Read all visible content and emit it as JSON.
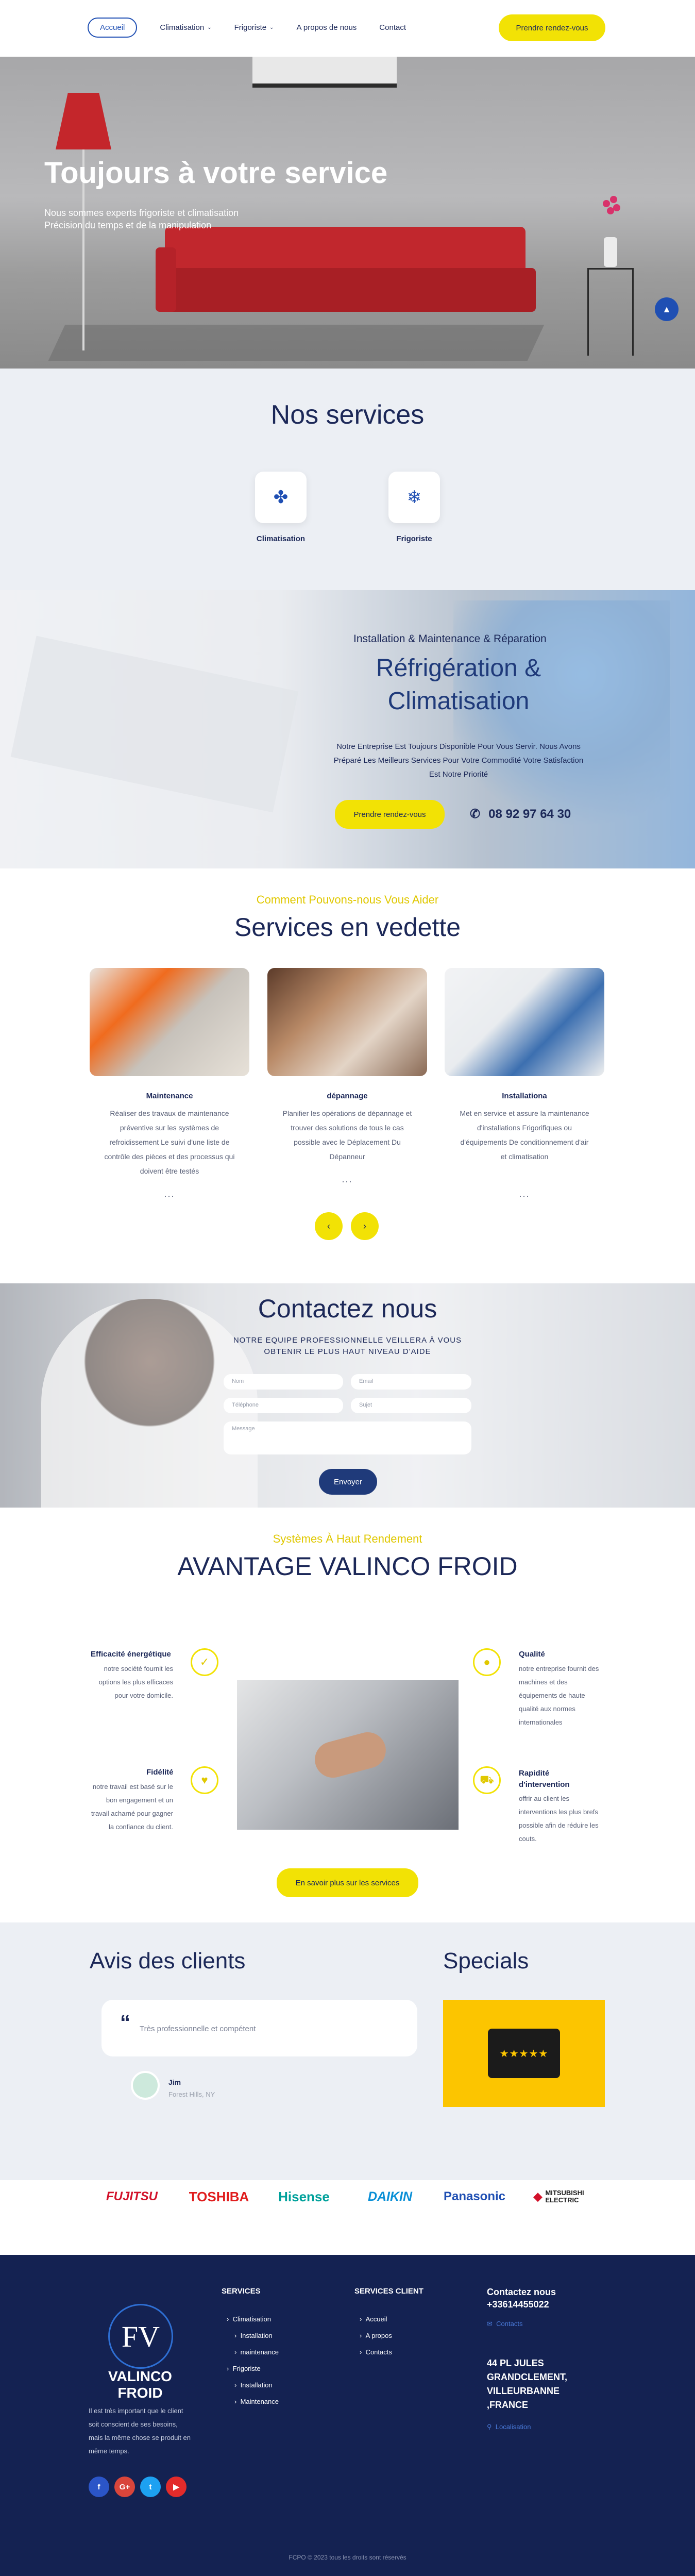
{
  "header": {
    "nav": [
      {
        "label": "Accueil"
      },
      {
        "label": "Climatisation"
      },
      {
        "label": "Frigoriste"
      },
      {
        "label": "A propos de nous"
      },
      {
        "label": "Contact"
      }
    ],
    "cta": "Prendre rendez-vous"
  },
  "hero": {
    "title": "Toujours à votre service",
    "line1": "Nous sommes experts frigoriste et climatisation",
    "line2": "Précision du temps et de la manipulation"
  },
  "services": {
    "title": "Nos services",
    "items": [
      {
        "label": "Climatisation",
        "icon": "fan-icon"
      },
      {
        "label": "Frigoriste",
        "icon": "snowflake-icon"
      }
    ]
  },
  "refrig": {
    "kicker": "Installation & Maintenance & Réparation",
    "title": "Réfrigération & Climatisation",
    "desc": "Notre Entreprise Est Toujours Disponible Pour Vous Servir. Nous Avons Préparé Les Meilleurs Services Pour Votre Commodité Votre Satisfaction Est Notre Priorité",
    "cta": "Prendre rendez-vous",
    "phone": "08 92 97 64 30"
  },
  "featured": {
    "kicker": "Comment Pouvons-nous Vous Aider",
    "title": "Services en vedette",
    "cards": [
      {
        "title": "Maintenance",
        "text": "Réaliser des travaux de maintenance préventive sur les systèmes de refroidissement Le suivi d'une liste de contrôle des pièces et des processus qui doivent être testés",
        "more": "..."
      },
      {
        "title": "dépannage",
        "text": "Planifier les opérations de dépannage et trouver des solutions de tous le cas possible avec le Déplacement Du Dépanneur",
        "more": "..."
      },
      {
        "title": "Installationa",
        "text": "Met en service et assure la maintenance d'installations Frigorifiques ou d'équipements De conditionnement d'air et climatisation",
        "more": "..."
      }
    ]
  },
  "contact": {
    "title": "Contactez nous",
    "sub": "NOTRE EQUIPE PROFESSIONNELLE VEILLERA À VOUS OBTENIR LE PLUS HAUT NIVEAU D'AIDE",
    "fields": {
      "name": "Nom",
      "email": "Email",
      "phone": "Téléphone",
      "subject": "Sujet",
      "message": "Message"
    },
    "send": "Envoyer"
  },
  "avantage": {
    "kicker": "Systèmes À Haut Rendement",
    "title": "AVANTAGE VALINCO FROID",
    "items": [
      {
        "title": "Efficacité énergétique",
        "text": "notre société fournit les options les plus efficaces pour votre domicile."
      },
      {
        "title": "Fidélité",
        "text": "notre travail est basé sur le bon engagement et un travail acharné pour gagner la confiance du client."
      },
      {
        "title": "Qualité",
        "text": "notre entreprise fournit des machines et des équipements de haute qualité aux normes internationales"
      },
      {
        "title": "Rapidité d'intervention",
        "text": "offrir au client les interventions les plus brefs possible afin de réduire les couts."
      }
    ],
    "cta": "En savoir plus sur les services"
  },
  "reviews": {
    "title": "Avis des clients",
    "text": "Très professionnelle et compétent",
    "name": "Jim",
    "location": "Forest Hills, NY"
  },
  "specials": {
    "title": "Specials",
    "stars": "★★★★★"
  },
  "brands": [
    "FUJITSU",
    "TOSHIBA",
    "Hisense",
    "DAIKIN",
    "Panasonic",
    "MITSUBISHI ELECTRIC"
  ],
  "footer": {
    "logo_mark": "FV",
    "logo": "VALINCO FROID",
    "about": "Il est très important que le client soit conscient de ses besoins, mais la même chose se produit en même temps.",
    "services_title": "SERVICES",
    "services": [
      "Climatisation",
      "Installation",
      "maintenance",
      "Frigoriste",
      "Installation",
      "Maintenance"
    ],
    "client_title": "SERVICES CLIENT",
    "client": [
      "Accueil",
      "A propos",
      "Contacts"
    ],
    "contact_title": "Contactez nous",
    "phone": "+33614455022",
    "contacts_link": "Contacts",
    "address": "44 PL JULES GRANDCLEMENT, VILLEURBANNE ,FRANCE",
    "location_link": "Localisation",
    "copyright": "FCPO © 2023 tous les droits sont réservés"
  },
  "colors": {
    "accent": "#f2e205",
    "primary": "#1c2858",
    "blue": "#1f4fb3",
    "footer": "#142252"
  }
}
